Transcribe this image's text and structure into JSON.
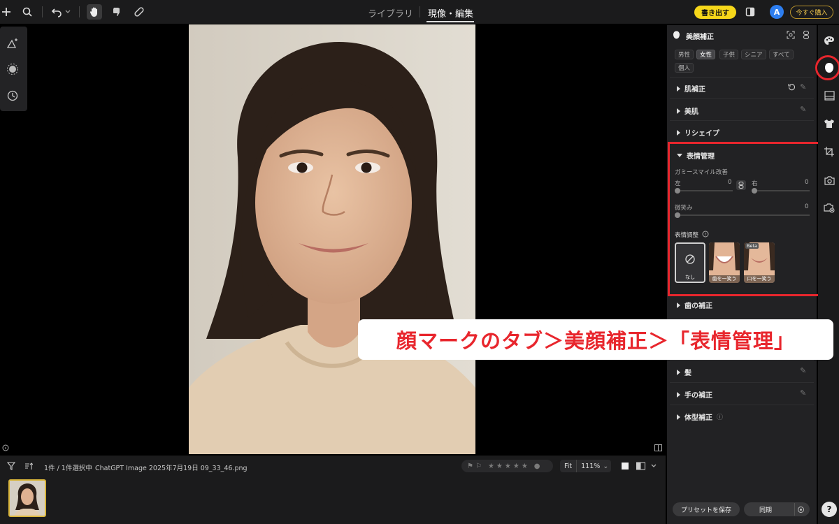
{
  "topbar": {
    "tab_library": "ライブラリ",
    "tab_develop": "現像・編集",
    "export_label": "書き出す",
    "avatar_initial": "A",
    "buy_label": "今すぐ購入"
  },
  "bottom": {
    "selection_count": "1件 / 1件選択中",
    "filename": "ChatGPT Image 2025年7月19日 09_33_46.png",
    "zoom_fit": "Fit",
    "zoom_value": "111%"
  },
  "panel": {
    "title": "美顔補正",
    "chips": [
      "男性",
      "女性",
      "子供",
      "シニア",
      "すべて",
      "個人"
    ],
    "selected_chip": "女性",
    "sections": {
      "skin_correction": "肌補正",
      "beauty_skin": "美肌",
      "reshape": "リシェイプ",
      "expression": "表情管理",
      "teeth": "歯の補正",
      "hair": "髪",
      "hands": "手の補正",
      "body": "体型補正"
    },
    "gummy_smile": "ガミースマイル改善",
    "left_label": "左",
    "left_value": "0",
    "right_label": "右",
    "right_value": "0",
    "smile_label": "微笑み",
    "smile_value": "0",
    "expression_adjust": "表情調整",
    "tiles": [
      {
        "label": "なし"
      },
      {
        "label": "歯を一笑う"
      },
      {
        "label": "口を一笑う",
        "badge": "Beta"
      }
    ],
    "save_preset": "プリセットを保存",
    "sync": "同期"
  },
  "help_label": "?",
  "caption": "顔マークのタブ＞美顔補正＞「表情管理」",
  "colors": {
    "accent_yellow": "#f6d71a",
    "highlight_red": "#e8262d",
    "avatar_blue": "#2d7ef0"
  }
}
